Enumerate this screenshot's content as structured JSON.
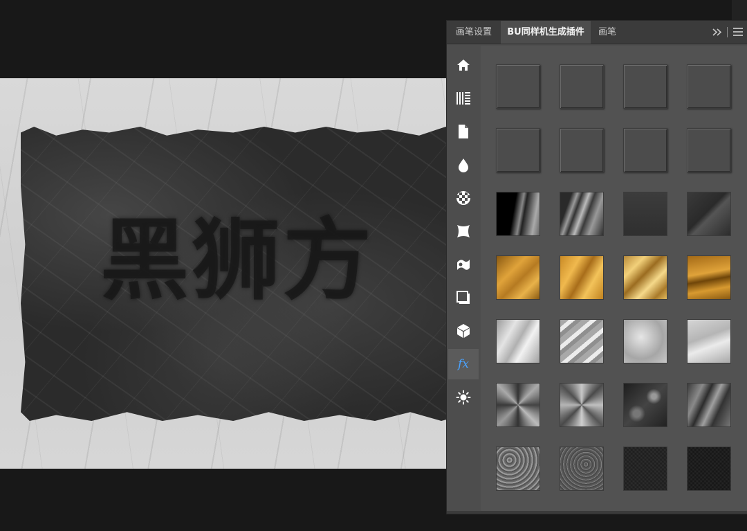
{
  "canvas": {
    "paper_text": "黑狮方"
  },
  "panel": {
    "tabs": [
      "画笔设置",
      "BU同样机生成插件",
      "画笔"
    ],
    "active_tab": 1,
    "sidebar": [
      {
        "icon": "home-icon",
        "active": false
      },
      {
        "icon": "barcode-pattern-icon",
        "active": false
      },
      {
        "icon": "document-icon",
        "active": false
      },
      {
        "icon": "droplet-icon",
        "active": false
      },
      {
        "icon": "checkerboard-icon",
        "active": false
      },
      {
        "icon": "warp-shape-icon",
        "active": false
      },
      {
        "icon": "wave-flag-icon",
        "active": false
      },
      {
        "icon": "drop-shadow-square-icon",
        "active": false
      },
      {
        "icon": "cube-icon",
        "active": false
      },
      {
        "icon": "fx-icon",
        "active": true,
        "label": "fx",
        "color": "#4aa3ff"
      },
      {
        "icon": "sun-icon",
        "active": false
      }
    ],
    "swatch_rows": [
      {
        "name": "bevel-gray",
        "items": [
          "plain",
          "plain",
          "plain",
          "plain"
        ]
      },
      {
        "name": "bevel-gray",
        "items": [
          "plain",
          "plain",
          "plain",
          "plain"
        ]
      },
      {
        "name": "dark-chrome",
        "items": [
          "dark-chrome-1",
          "dark-chrome-2",
          "dark-chrome-3",
          "dark-chrome-4"
        ]
      },
      {
        "name": "gold",
        "items": [
          "gold-1",
          "gold-2",
          "gold-3",
          "gold-4"
        ]
      },
      {
        "name": "silver",
        "items": [
          "silver-1",
          "silver-2",
          "silver-3",
          "silver-4"
        ]
      },
      {
        "name": "brushed-metal",
        "items": [
          "radial-metal-1",
          "radial-metal-2",
          "grunge-metal-1",
          "foil-metal-1"
        ]
      },
      {
        "name": "rough-texture",
        "items": [
          "rock-1",
          "rock-2",
          "fabric-1",
          "fabric-2"
        ]
      }
    ],
    "colors": {
      "gold_light": "#e0a33a",
      "gold_dark": "#8a5a12",
      "silver_light": "#e4e4e4",
      "silver_dark": "#9a9a9a",
      "fx_accent": "#4aa3ff"
    }
  }
}
